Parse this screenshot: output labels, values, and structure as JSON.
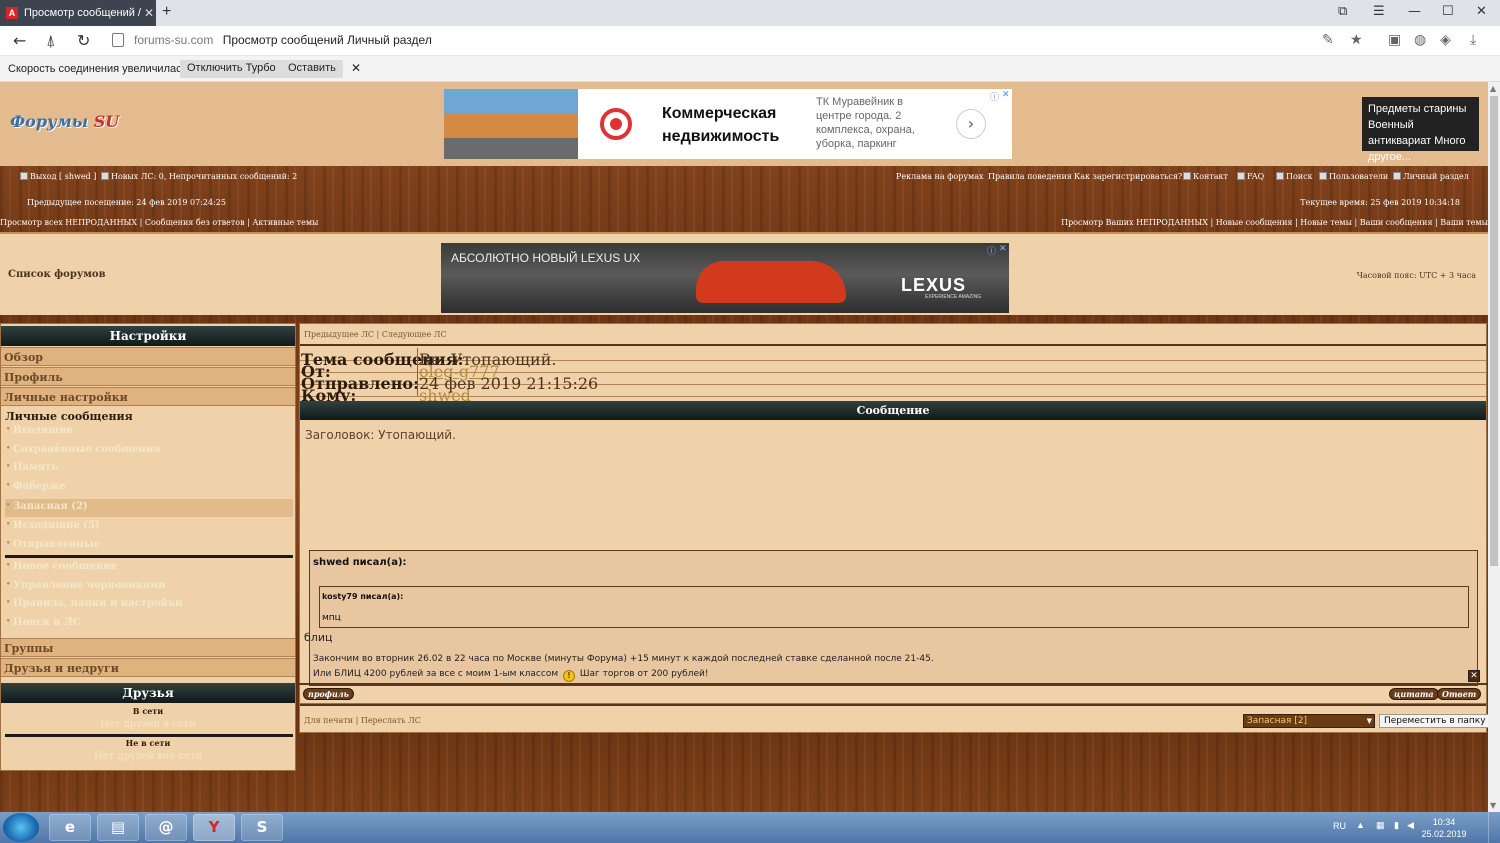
{
  "browser": {
    "tab_title": "Просмотр сообщений /",
    "tab_favicon": "A",
    "new_tab": "+",
    "url_domain": "forums-su.com",
    "page_title": "Просмотр сообщений Личный раздел",
    "turbo_message": "Скорость соединения увеличилась.",
    "turbo_disable": "Отключить Турбо",
    "turbo_keep": "Оставить",
    "turbo_close": "✕"
  },
  "header": {
    "logo_main": "Форумы",
    "logo_su": "SU",
    "ad_headline": "Коммерческая недвижимость",
    "ad_description": "ТК Муравейник в центре города. 2 комплекса, охрана, уборка, паркинг",
    "side_ad": "Предметы старины Военный антиквариат Много другое..."
  },
  "topnav": {
    "logout": "Выход [ shwed ]",
    "new_pm": "Новых ЛС: 0, Непрочитанных сообщений: 2",
    "links": [
      "Реклама на форумах",
      "Правила поведения",
      "Как зарегистрироваться?",
      "Контакт",
      "FAQ",
      "Поиск",
      "Пользователи",
      "Личный раздел"
    ],
    "last_visit": "Предыдущее посещение: 24 фев 2019 07:24:25",
    "current_time": "Текущее время: 25 фев 2019 10:34:18",
    "left_links": "Просмотр всех НЕПРОДАННЫХ | Сообщения без ответов | Активные темы",
    "right_links": "Просмотр Ваших НЕПРОДАННЫХ | Новые сообщения | Новые темы | Ваши сообщения | Ваши темы"
  },
  "banner": {
    "forum_list": "Список форумов",
    "ad_caption": "АБСОЛЮТНО НОВЫЙ LEXUS UX",
    "ad_brand": "LEXUS",
    "ad_sub": "EXPERIENCE AMAZING",
    "timezone": "Часовой пояс: UTC + 3 часа"
  },
  "sidebar": {
    "title": "Настройки",
    "menu": [
      "Обзор",
      "Профиль",
      "Личные настройки"
    ],
    "pm_section": "Личные сообщения",
    "pm_items": [
      "Входящие",
      "Сохранённые сообщения",
      "Память",
      "Фаберже",
      "Запасная (2)",
      "Исходящие (5)",
      "Отправленные"
    ],
    "pm_actions": [
      "Новое сообщение",
      "Управление черновиками",
      "Правила, папки и настройки",
      "Поиск в ЛС"
    ],
    "groups": "Группы",
    "friends_foes": "Друзья и недруги",
    "friends_title": "Друзья",
    "online_label": "В сети",
    "online_text": "Нет друзей в сети",
    "offline_label": "Не в сети",
    "offline_text": "Нет друзей вне сети"
  },
  "message": {
    "nav": "Предыдущее ЛС | Следующее ЛС",
    "subject_label": "Тема сообщения:",
    "subject": "Re: Утопающий.",
    "from_label": "От:",
    "from": "oleg-g777",
    "sent_label": "Отправлено:",
    "sent": "24 фев 2019 21:15:26",
    "to_label": "Кому:",
    "to": "shwed",
    "panel_title": "Сообщение",
    "heading": "Заголовок: Утопающий.",
    "quote_author": "shwed писал(а):",
    "inner_quote_author": "kosty79 писал(а):",
    "inner_quote_text": "мпц",
    "line1": "Закончим во вторник 26.02 в 22 часа по Москве (минуты Форума) +15 минут к каждой последней ставке сделанной после 21-45.",
    "line2a": "Или БЛИЦ 4200 рублей за все с моим 1-ым классом",
    "line2b": "Шаг торгов от 200 рублей!",
    "reply_text": "блиц",
    "profile_btn": "профиль",
    "quote_btn": "цитата",
    "reply_btn": "Ответ",
    "print_link": "Для печати",
    "forward_link": "Переслать ЛС",
    "folder_select": "Запасная [2]",
    "move_btn": "Переместить в папку"
  },
  "taskbar": {
    "lang": "RU",
    "time": "10:34",
    "date": "25.02.2019"
  }
}
